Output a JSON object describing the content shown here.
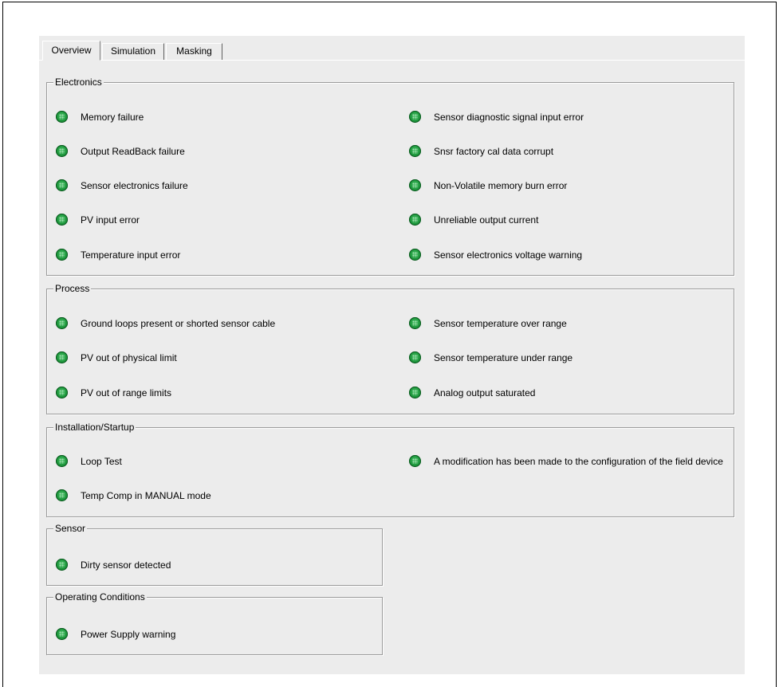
{
  "tabs": [
    {
      "label": "Overview",
      "active": true
    },
    {
      "label": "Simulation",
      "active": false
    },
    {
      "label": "Masking",
      "active": false
    }
  ],
  "status_color": "#1f9a3e",
  "groups": {
    "electronics": {
      "title": "Electronics",
      "left": [
        "Memory failure",
        "Output ReadBack failure",
        "Sensor electronics failure",
        "PV input error",
        "Temperature input error"
      ],
      "right": [
        "Sensor diagnostic signal input error",
        "Snsr factory cal data corrupt",
        "Non-Volatile memory burn error",
        "Unreliable output current",
        "Sensor electronics voltage warning"
      ]
    },
    "process": {
      "title": "Process",
      "left": [
        "Ground loops present or shorted sensor cable",
        "PV out of physical limit",
        "PV out of range limits"
      ],
      "right": [
        "Sensor temperature over range",
        "Sensor temperature under range",
        "Analog output saturated"
      ]
    },
    "installation": {
      "title": "Installation/Startup",
      "left": [
        "Loop Test",
        "Temp Comp in MANUAL mode"
      ],
      "right": [
        "A modification has been made to the configuration of the field device"
      ]
    },
    "sensor": {
      "title": "Sensor",
      "left": [
        "Dirty sensor detected"
      ]
    },
    "operating": {
      "title": "Operating Conditions",
      "left": [
        "Power Supply warning"
      ]
    }
  }
}
